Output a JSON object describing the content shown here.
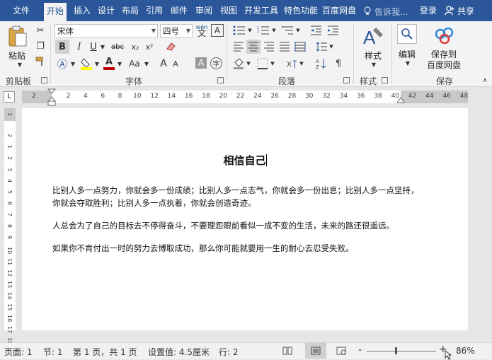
{
  "tabs": [
    "文件",
    "开始",
    "插入",
    "设计",
    "布局",
    "引用",
    "邮件",
    "审阅",
    "视图",
    "开发工具",
    "特色功能",
    "百度网盘"
  ],
  "active_tab": "开始",
  "search_placeholder": "告诉我...",
  "login": "登录",
  "share": "共享",
  "clipboard": {
    "paste": "粘贴",
    "group": "剪贴板"
  },
  "font": {
    "name": "宋体",
    "size": "四号",
    "group": "字体",
    "phonetic": "wén",
    "style_labels": {
      "bold": "B",
      "italic": "I",
      "underline": "U",
      "strike": "abc",
      "sub": "x₂",
      "sup": "x²",
      "grow": "A",
      "shrink": "A",
      "case": "Aa"
    }
  },
  "paragraph": {
    "group": "段落"
  },
  "styles": {
    "label": "样式",
    "group": "样式"
  },
  "editing": {
    "label": "编辑"
  },
  "save": {
    "label1": "保存到",
    "label2": "百度网盘",
    "group": "保存"
  },
  "ruler": {
    "h_ticks": [
      "2",
      "2",
      "4",
      "6",
      "8",
      "10",
      "12",
      "14",
      "16",
      "18",
      "20",
      "22",
      "24",
      "26",
      "28",
      "30",
      "32",
      "34",
      "36",
      "38",
      "40",
      "42",
      "44",
      "46",
      "48"
    ],
    "v_ticks": [
      "1",
      "2",
      "1",
      "2",
      "3",
      "4",
      "5",
      "6",
      "7",
      "8",
      "9",
      "10",
      "11",
      "12",
      "13",
      "14",
      "15",
      "16",
      "17",
      "18"
    ],
    "corner": "L"
  },
  "document": {
    "title": "相信自己",
    "paragraphs": [
      "比别人多一点努力，你就会多一份成绩；比别人多一点志气，你就会多一份出息；比别人多一点坚持，你就会夺取胜利；比别人多一点执着，你就会创造奇迹。",
      "人总会为了自己的目标去不停得奋斗，不要理怨眼前看似一成不变的生活，未来的路还很遥远。",
      "如果你不肯付出一时的努力去博取成功，那么你可能就要用一生的耐心去忍受失败。"
    ]
  },
  "status": {
    "page": "页面: 1",
    "section": "节: 1",
    "pages": "第 1 页，共 1 页",
    "settings": "设置值: 4.5厘米",
    "row": "行: 2",
    "zoom": "86%",
    "zoom_minus": "-",
    "zoom_plus": "+"
  },
  "colors": {
    "accent": "#2b579a",
    "highlight": "#ffff00",
    "font_color": "#c00000"
  }
}
